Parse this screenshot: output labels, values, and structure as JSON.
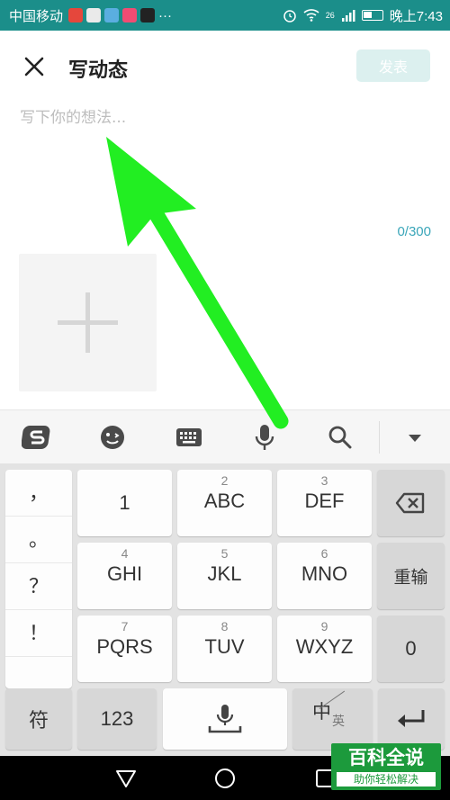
{
  "status_bar": {
    "carrier": "中国移动",
    "time": "晚上7:43",
    "network": "26"
  },
  "header": {
    "title": "写动态",
    "publish_label": "发表"
  },
  "composer": {
    "placeholder": "写下你的想法...",
    "char_count": "0/300"
  },
  "keyboard": {
    "punctuation": [
      "，",
      "。",
      "？",
      "！"
    ],
    "keys": [
      {
        "digit": "",
        "label": "1"
      },
      {
        "digit": "2",
        "label": "ABC"
      },
      {
        "digit": "3",
        "label": "DEF"
      },
      {
        "digit": "4",
        "label": "GHI"
      },
      {
        "digit": "5",
        "label": "JKL"
      },
      {
        "digit": "6",
        "label": "MNO"
      },
      {
        "digit": "7",
        "label": "PQRS"
      },
      {
        "digit": "8",
        "label": "TUV"
      },
      {
        "digit": "9",
        "label": "WXYZ"
      }
    ],
    "reenter_label": "重输",
    "zero_label": "0",
    "symbol_label": "符",
    "numeric_label": "123",
    "lang_main": "中",
    "lang_sub": "英"
  },
  "watermark": {
    "title": "百科全说",
    "subtitle": "助你轻松解决"
  },
  "colors": {
    "status_bar": "#1b8e8a",
    "accent": "#3aa6b9",
    "arrow": "#22ee22",
    "watermark": "#1c9a3c"
  }
}
